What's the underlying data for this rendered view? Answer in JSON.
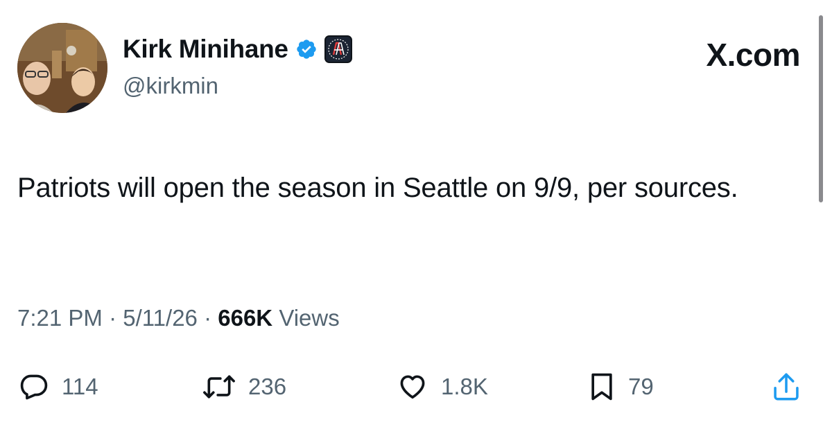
{
  "author": {
    "name": "Kirk Minihane",
    "handle": "@kirkmin"
  },
  "site": {
    "logo": "X.com"
  },
  "tweet": {
    "text": "Patriots will open the season in Seattle on 9/9, per sources.",
    "time": "7:21 PM",
    "date": "5/11/26",
    "views_count": "666K",
    "views_label": "Views",
    "separator": "·"
  },
  "actions": {
    "replies": "114",
    "reposts": "236",
    "likes": "1.8K",
    "bookmarks": "79"
  },
  "colors": {
    "verified": "#1d9bf0",
    "text_primary": "#0f1419",
    "text_secondary": "#536471"
  },
  "icons": {
    "verified": "verified-badge-icon",
    "affiliate": "barstool-affiliate-icon",
    "reply": "reply-icon",
    "repost": "repost-icon",
    "like": "heart-icon",
    "bookmark": "bookmark-icon",
    "share": "share-icon"
  }
}
